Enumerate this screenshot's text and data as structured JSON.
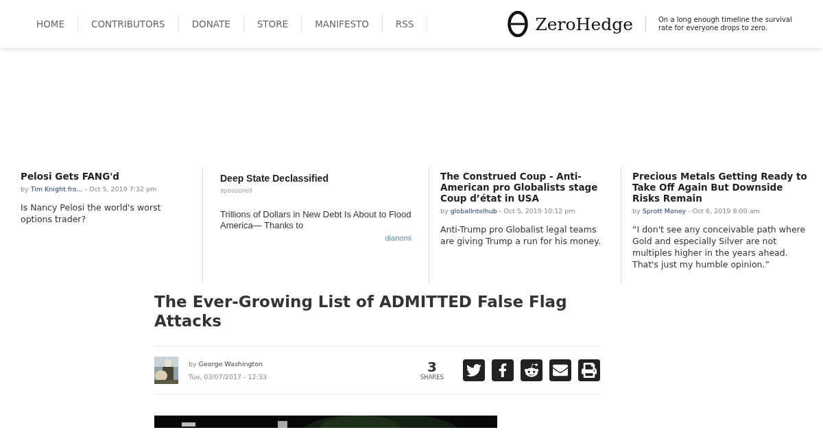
{
  "nav": {
    "items": [
      {
        "label": "HOME"
      },
      {
        "label": "CONTRIBUTORS"
      },
      {
        "label": "DONATE"
      },
      {
        "label": "STORE"
      },
      {
        "label": "MANIFESTO"
      },
      {
        "label": "RSS"
      }
    ]
  },
  "logo": {
    "name": "ZeroHedge",
    "tagline": "On a long enough timeline the survival rate for everyone drops to zero."
  },
  "teasers": [
    {
      "kind": "story",
      "title": "Pelosi Gets FANG'd",
      "by": "by",
      "author": "Tim Knight fro...",
      "date": "- Oct 5, 2019 7:32 pm",
      "summary": "Is Nancy Pelosi the world's worst options trader?"
    },
    {
      "kind": "sponsored",
      "title": "Deep State Declassified",
      "label": "sponsored",
      "summary": "Trillions of Dollars in New Debt Is About to Flood America— Thanks to",
      "brand": "dianomi"
    },
    {
      "kind": "story",
      "title": "The Construed Coup - Anti-American pro Globalists stage Coup d’état in USA",
      "by": "by",
      "author": "globalIntelhub",
      "date": "- Oct 5, 2019 10:12 pm",
      "summary": "Anti-Trump pro Globalist legal teams are giving Trump a run for his money."
    },
    {
      "kind": "story",
      "title": "Precious Metals Getting Ready to Take Off Again But Downside Risks Remain",
      "by": "by",
      "author": "Sprott Money",
      "date": "- Oct 6, 2019 8:00 am",
      "summary": "“I don't see any conceivable path where Gold and especially Silver are not multiples higher in the years ahead. That's just my humble opinion.”"
    }
  ],
  "article": {
    "title": "The Ever-Growing List of ADMITTED False Flag Attacks",
    "by": "by",
    "author": "George Washington",
    "date": "Tue, 03/07/2017 - 12:33",
    "shares": "3",
    "shares_label": "SHARES"
  }
}
